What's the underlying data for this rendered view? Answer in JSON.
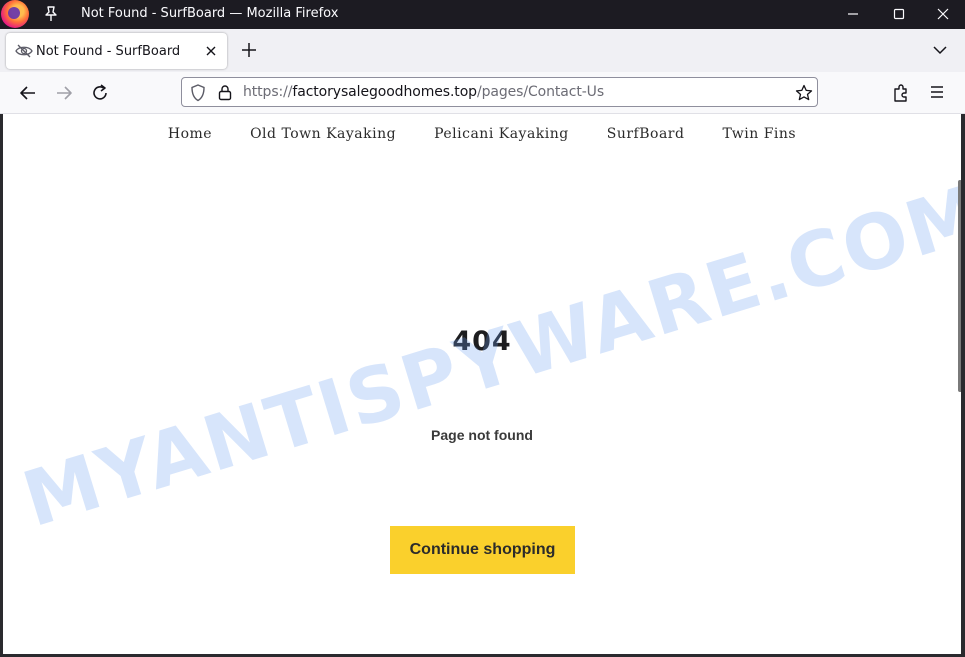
{
  "window": {
    "title": "Not Found - SurfBoard — Mozilla Firefox"
  },
  "tab": {
    "title": "Not Found - SurfBoard"
  },
  "urlbar": {
    "scheme": "https://",
    "domain": "factorysalegoodhomes.top",
    "path": "/pages/Contact-Us"
  },
  "site_nav": {
    "items": [
      "Home",
      "Old Town Kayaking",
      "Pelicani Kayaking",
      "SurfBoard",
      "Twin Fins"
    ]
  },
  "error": {
    "code": "404",
    "message": "Page not found",
    "button_label": "Continue shopping"
  },
  "watermark": {
    "text": "MYANTISPYWARE.COM"
  },
  "colors": {
    "titlebar": "#1c1b22",
    "tabstrip": "#f0f0f4",
    "button_accent": "#fad02c"
  }
}
